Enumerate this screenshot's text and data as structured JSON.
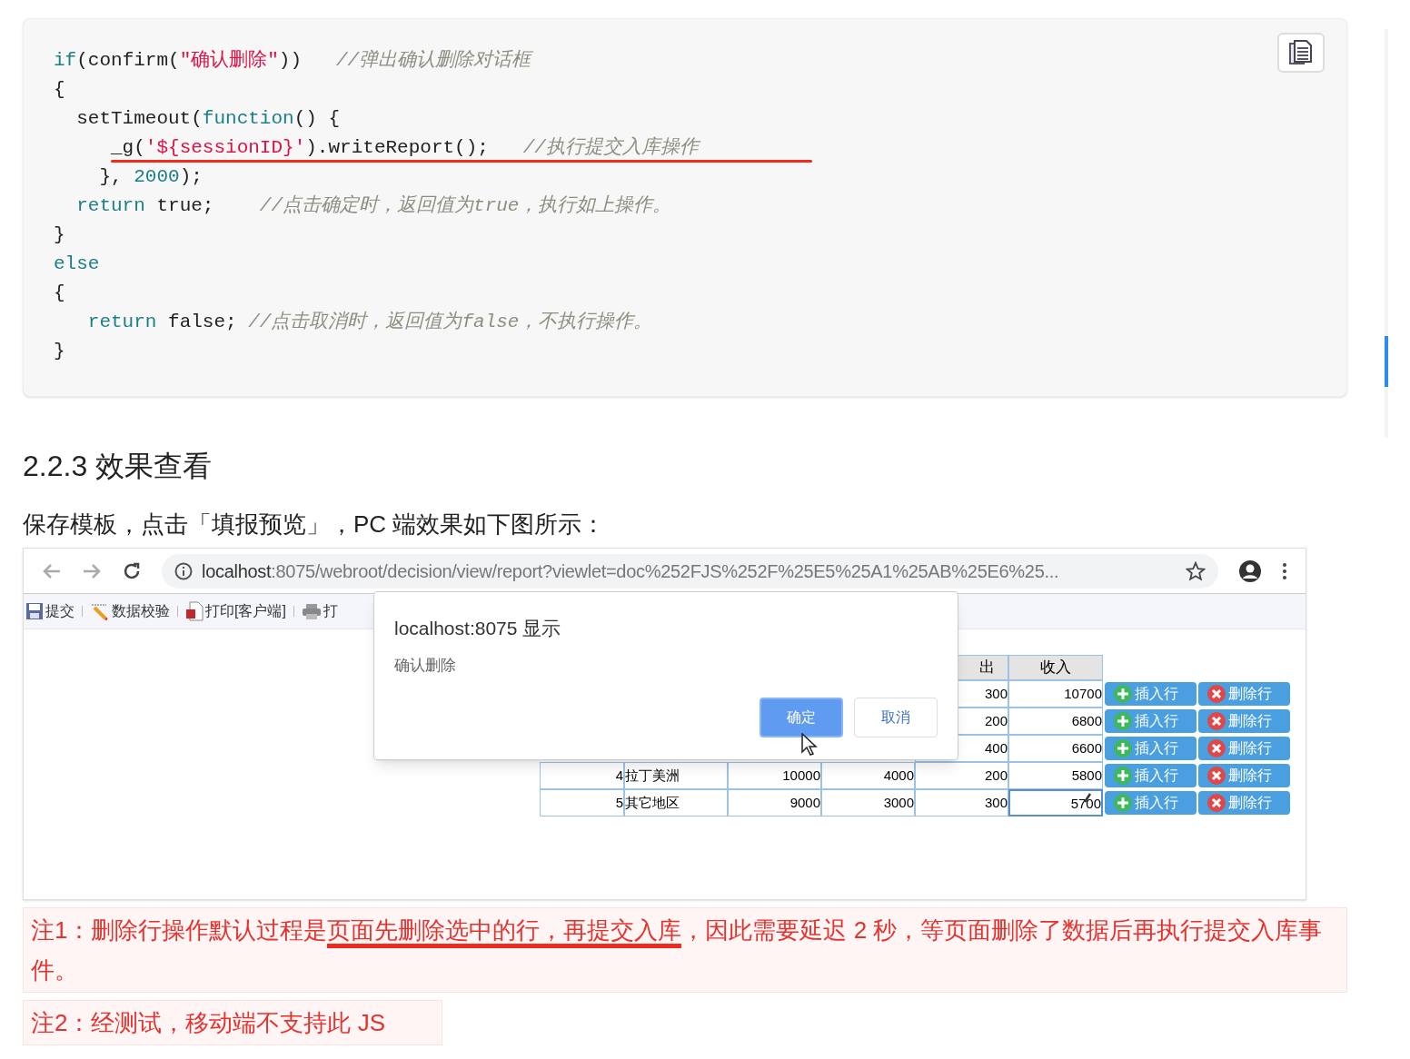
{
  "code_block": {
    "lines": [
      {
        "tokens": [
          {
            "kind": "keyword",
            "text": "if"
          },
          {
            "kind": "plain",
            "text": "(confirm("
          },
          {
            "kind": "string",
            "text": "\"确认删除\""
          },
          {
            "kind": "plain",
            "text": "))   "
          },
          {
            "kind": "comment",
            "text": "//弹出确认删除对话框"
          }
        ]
      },
      {
        "tokens": [
          {
            "kind": "plain",
            "text": "{"
          }
        ]
      },
      {
        "tokens": [
          {
            "kind": "plain",
            "text": "  setTimeout("
          },
          {
            "kind": "keyword",
            "text": "function"
          },
          {
            "kind": "plain",
            "text": "() {"
          }
        ]
      },
      {
        "underlined": true,
        "tokens": [
          {
            "kind": "plain",
            "text": "     _g("
          },
          {
            "kind": "string",
            "text": "'${sessionID}'"
          },
          {
            "kind": "plain",
            "text": ").writeReport();   "
          },
          {
            "kind": "comment",
            "text": "//执行提交入库操作"
          }
        ]
      },
      {
        "tokens": [
          {
            "kind": "plain",
            "text": "    }, "
          },
          {
            "kind": "number",
            "text": "2000"
          },
          {
            "kind": "plain",
            "text": ");"
          }
        ]
      },
      {
        "tokens": [
          {
            "kind": "keyword",
            "text": "  return"
          },
          {
            "kind": "plain",
            "text": " true;    "
          },
          {
            "kind": "comment",
            "text": "//点击确定时，返回值为true，执行如上操作。"
          }
        ]
      },
      {
        "tokens": [
          {
            "kind": "plain",
            "text": "}"
          }
        ]
      },
      {
        "tokens": [
          {
            "kind": "keyword",
            "text": "else"
          }
        ]
      },
      {
        "tokens": [
          {
            "kind": "plain",
            "text": "{"
          }
        ]
      },
      {
        "tokens": [
          {
            "kind": "keyword",
            "text": "   return"
          },
          {
            "kind": "plain",
            "text": " false; "
          },
          {
            "kind": "comment",
            "text": "//点击取消时，返回值为false，不执行操作。"
          }
        ]
      },
      {
        "tokens": [
          {
            "kind": "plain",
            "text": "}"
          }
        ]
      }
    ]
  },
  "heading": "2.2.3 效果查看",
  "intro": "保存模板，点击「填报预览」，PC 端效果如下图所示：",
  "browser": {
    "url_host": "localhost",
    "url_rest": ":8075/webroot/decision/view/report?viewlet=doc%252FJS%252F%25E5%25A1%25AB%25E6%25...",
    "toolbar": [
      {
        "kind": "save",
        "label": "提交"
      },
      {
        "kind": "pencil",
        "label": "数据校验"
      },
      {
        "kind": "pdf",
        "label": "打印[客户端]"
      },
      {
        "kind": "printer",
        "label": "打"
      }
    ],
    "dialog": {
      "title": "localhost:8075 显示",
      "message": "确认删除",
      "buttons": [
        {
          "label": "确定",
          "selected": true
        },
        {
          "label": "取消",
          "selected": false
        }
      ]
    },
    "table": {
      "header": [
        "出",
        "收入"
      ],
      "rows": [
        {
          "cells": [
            "300",
            "10700"
          ],
          "editing": false,
          "actions": [
            "插入行",
            "删除行"
          ]
        },
        {
          "cells": [
            "200",
            "6800"
          ],
          "editing": false,
          "actions": [
            "插入行",
            "删除行"
          ]
        },
        {
          "cells": [
            "400",
            "6600"
          ],
          "editing": false,
          "actions": [
            "插入行",
            "删除行"
          ]
        },
        {
          "cells": [
            "4",
            "拉丁美洲",
            "10000",
            "4000",
            "200",
            "5800"
          ],
          "editing": false,
          "actions": [
            "插入行",
            "删除行"
          ]
        },
        {
          "cells": [
            "5",
            "其它地区",
            "9000",
            "3000",
            "300",
            "5700"
          ],
          "editing": true,
          "actions": [
            "插入行",
            "删除行"
          ]
        }
      ]
    }
  },
  "notes": [
    {
      "segments": [
        {
          "text": "注1：删除行操作默认过程是"
        },
        {
          "text": "页面先删除选中的行，再提交入库",
          "underlined": true
        },
        {
          "text": "，因此需要延迟 2 秒，等页面删除了数据后再执行提交入库事件。"
        }
      ]
    },
    {
      "segments": [
        {
          "text": "注2：经测试，移动端不支持此 JS"
        }
      ]
    }
  ]
}
